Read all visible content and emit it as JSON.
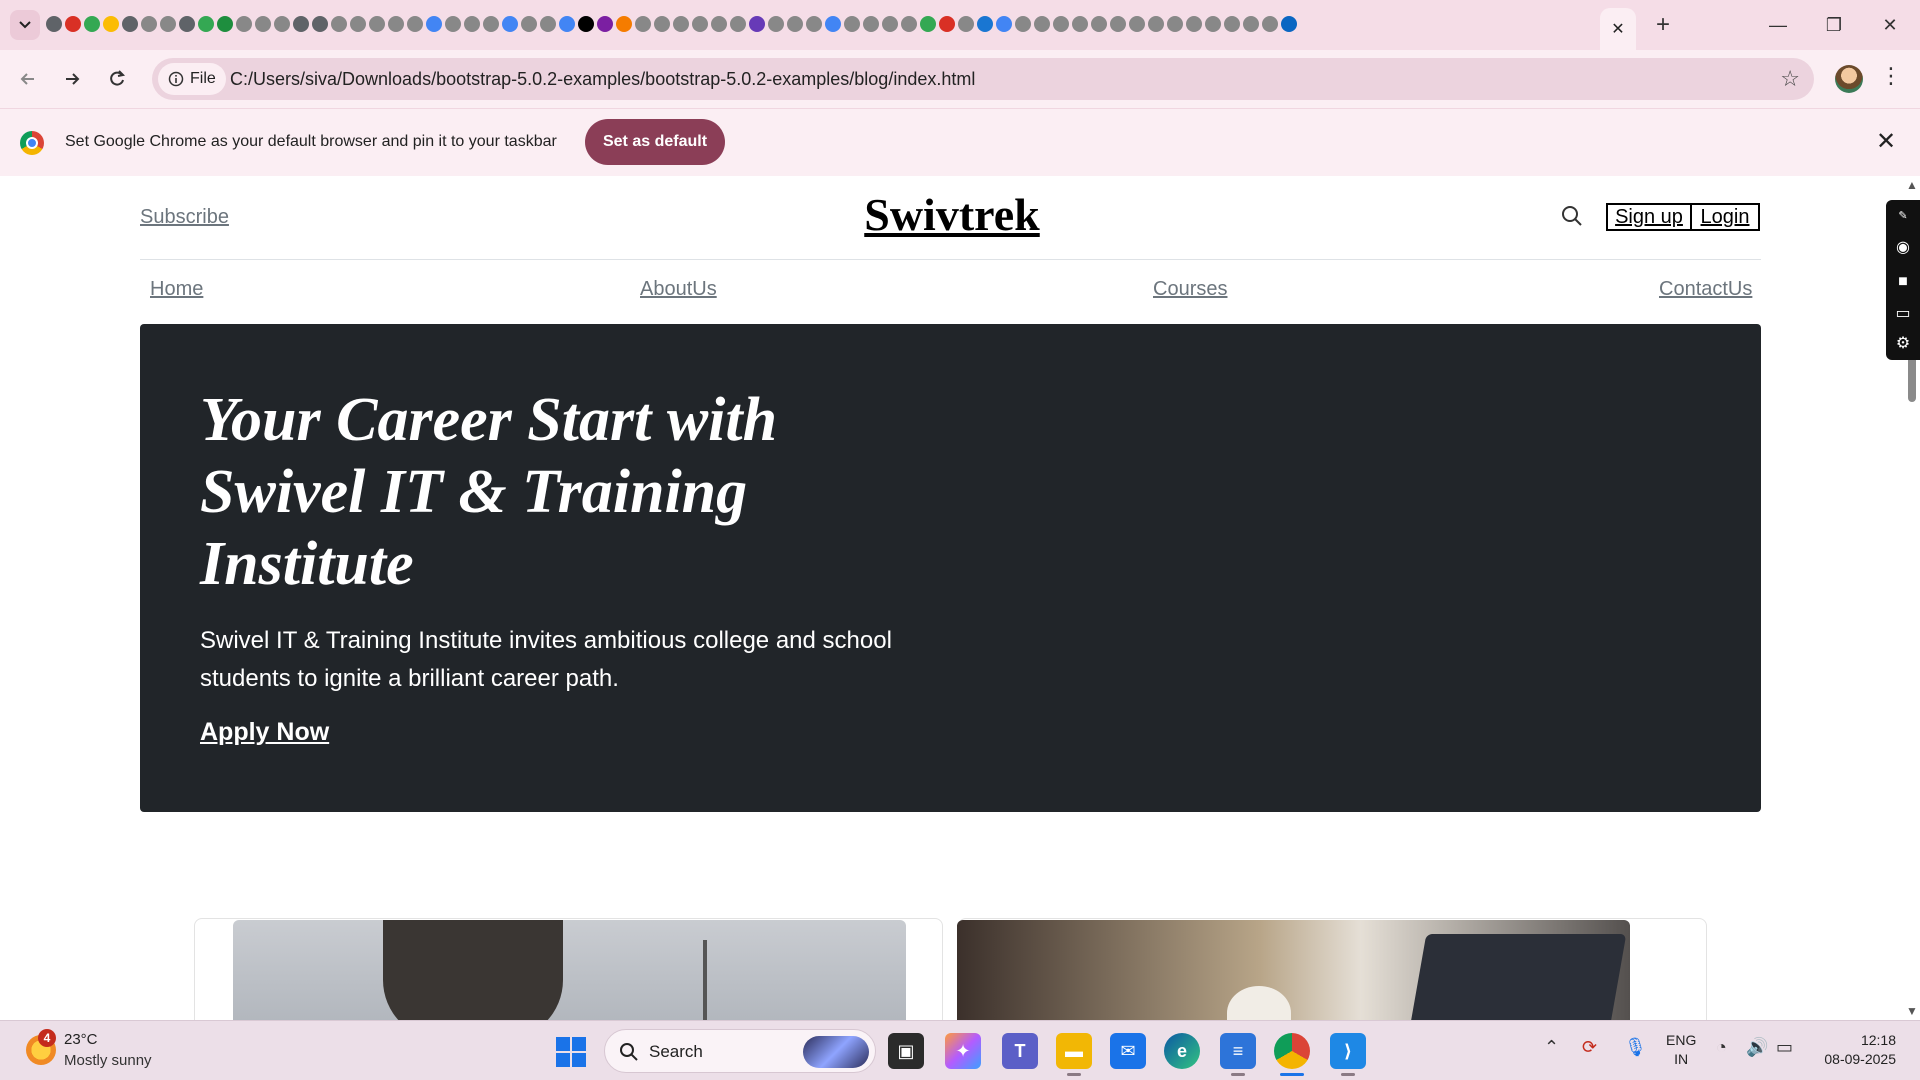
{
  "browser": {
    "tab_favicons": [
      "#5f6368",
      "#d93025",
      "#34a853",
      "#fbbc04",
      "#5f6368",
      "#888",
      "#888",
      "#5f6368",
      "#34a853",
      "#1e8e3e",
      "#888",
      "#888",
      "#888",
      "#5f6368",
      "#5f6368",
      "#888",
      "#888",
      "#888",
      "#888",
      "#888",
      "#4285f4",
      "#888",
      "#888",
      "#888",
      "#4285f4",
      "#888",
      "#888",
      "#4285f4",
      "#000",
      "#7b1fa2",
      "#f57c00",
      "#888",
      "#888",
      "#888",
      "#888",
      "#888",
      "#888",
      "#673ab7",
      "#888",
      "#888",
      "#888",
      "#4285f4",
      "#888",
      "#888",
      "#888",
      "#888",
      "#34a853",
      "#d93025",
      "#888",
      "#1976d2",
      "#4285f4",
      "#888",
      "#888",
      "#888",
      "#888",
      "#888",
      "#888",
      "#888",
      "#888",
      "#888",
      "#888",
      "#888",
      "#888",
      "#888",
      "#888",
      "#0a66c2"
    ],
    "active_tab_close": "✕",
    "new_tab": "+",
    "window": {
      "minimize": "—",
      "restore": "❐",
      "close": "✕"
    },
    "file_chip": "File",
    "url": "C:/Users/siva/Downloads/bootstrap-5.0.2-examples/bootstrap-5.0.2-examples/blog/index.html",
    "infobar": {
      "message": "Set Google Chrome as your default browser and pin it to your taskbar",
      "button": "Set as default",
      "close": "✕"
    }
  },
  "page": {
    "subscribe": "Subscribe",
    "brand": "Swivtrek",
    "signup": "Sign up",
    "login": "Login",
    "nav": [
      "Home",
      "AboutUs",
      "Courses",
      "ContactUs"
    ],
    "hero": {
      "title": "Your Career Start with Swivel IT & Training Institute",
      "lead": "Swivel IT & Training Institute invites ambitious college and school students to ignite a brilliant career path.",
      "cta": "Apply Now"
    }
  },
  "taskbar": {
    "weather": {
      "temp": "23°C",
      "condition": "Mostly sunny",
      "badge": "4"
    },
    "search_label": "Search",
    "language": [
      "ENG",
      "IN"
    ],
    "time": "12:18",
    "date": "08-09-2025"
  }
}
